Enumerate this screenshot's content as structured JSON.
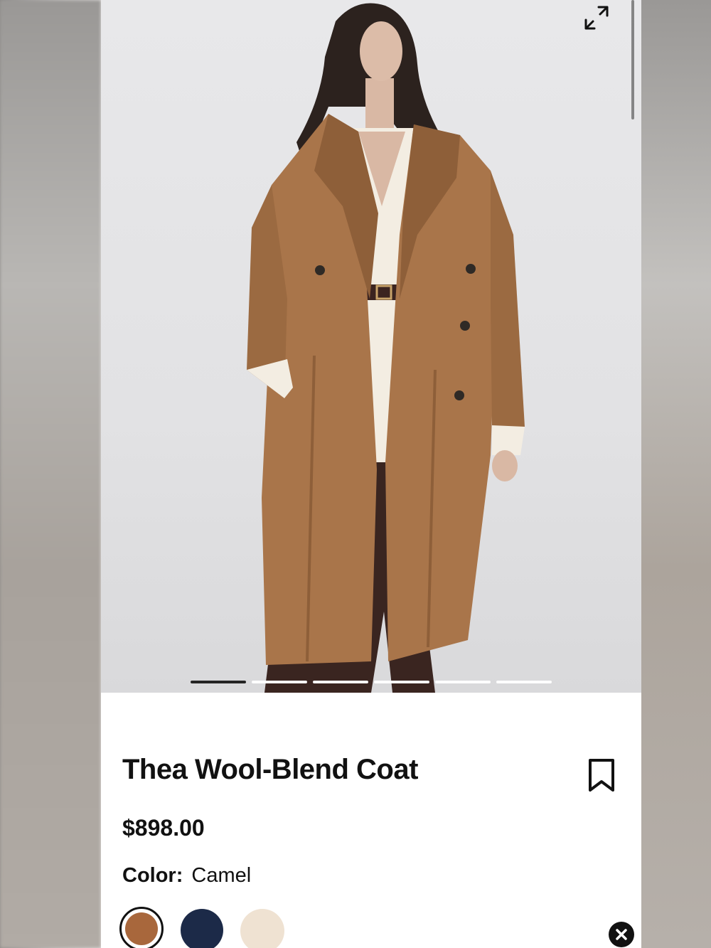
{
  "product": {
    "title": "Thea Wool-Blend Coat",
    "price": "$898.00",
    "color_label": "Color:",
    "color_value": "Camel"
  },
  "gallery": {
    "image_count": 6,
    "active_index": 0
  },
  "icons": {
    "expand": "expand-arrows-icon",
    "bookmark": "bookmark-icon",
    "close": "close-icon"
  },
  "swatches": [
    {
      "name": "camel",
      "color": "#a8673c",
      "selected": true
    },
    {
      "name": "navy",
      "color": "#1c2a48",
      "selected": false
    },
    {
      "name": "cream",
      "color": "#efe2d2",
      "selected": false
    }
  ],
  "colors": {
    "coat": "#a9754a",
    "coat_shadow": "#8e5f39",
    "sweater": "#f3ede2",
    "hair": "#2c221e",
    "skin": "#d9b8a4",
    "trousers": "#3a2520",
    "text": "#111111"
  }
}
